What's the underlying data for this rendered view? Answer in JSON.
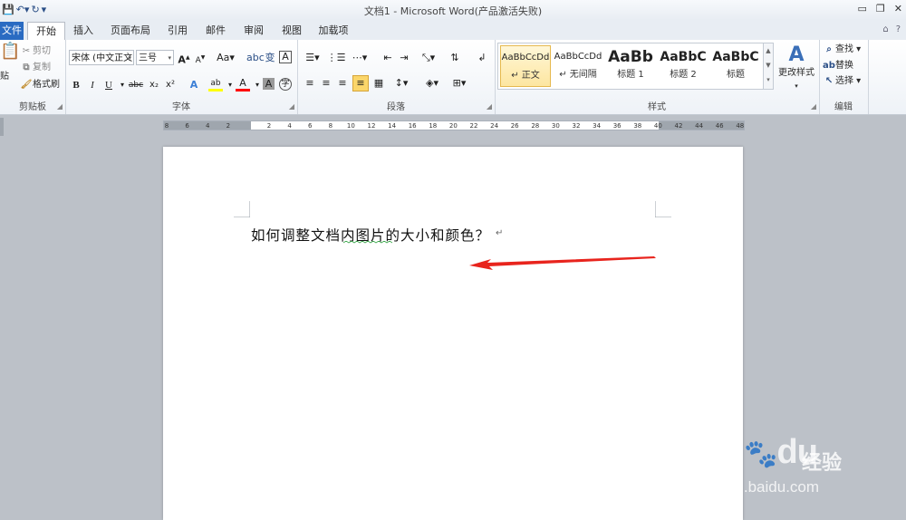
{
  "window": {
    "title": "文档1 - Microsoft Word(产品激活失败)",
    "qat": [
      "save-icon",
      "undo-icon",
      "redo-icon",
      "customize-icon"
    ]
  },
  "tabs": [
    "文件",
    "开始",
    "插入",
    "页面布局",
    "引用",
    "邮件",
    "审阅",
    "视图",
    "加载项"
  ],
  "active_tab": "开始",
  "clipboard": {
    "paste": "贴",
    "cut": "剪切",
    "copy": "复制",
    "format_painter": "格式刷",
    "label": "剪贴板"
  },
  "font": {
    "font_name": "宋体 (中文正文",
    "font_size": "三号",
    "grow": "A",
    "shrink": "A",
    "case": "Aa",
    "bold": "B",
    "italic": "I",
    "underline": "U",
    "strike": "abc",
    "subscript": "x₂",
    "superscript": "x²",
    "text_effect": "A",
    "highlight": "ab",
    "font_color": "A",
    "shade": "A",
    "label": "字体"
  },
  "paragraph": {
    "label": "段落"
  },
  "styles": {
    "items": [
      {
        "sample": "AaBbCcDd",
        "name": "正文",
        "prefix": "↵"
      },
      {
        "sample": "AaBbCcDd",
        "name": "无间隔",
        "prefix": "↵"
      },
      {
        "sample": "AaBb",
        "name": "标题 1"
      },
      {
        "sample": "AaBbC",
        "name": "标题 2"
      },
      {
        "sample": "AaBbC",
        "name": "标题"
      }
    ],
    "change_styles": "更改样式",
    "label": "样式"
  },
  "editing": {
    "find": "查找",
    "replace": "替换",
    "select": "选择",
    "label": "编辑"
  },
  "ruler_numbers": [
    "8",
    "6",
    "4",
    "2",
    "",
    "2",
    "4",
    "6",
    "8",
    "10",
    "12",
    "14",
    "16",
    "18",
    "20",
    "22",
    "24",
    "26",
    "28",
    "30",
    "32",
    "34",
    "36",
    "38",
    "40",
    "42",
    "44",
    "46",
    "48"
  ],
  "document": {
    "text": "如何调整文档内图片的大小和颜色？",
    "return_mark": "↵"
  },
  "watermark": {
    "brand": "Bai",
    "brand2": "du",
    "jingyan": "经验",
    "url": "jingyan.baidu.com"
  },
  "colors": {
    "file_tab": "#2a6bc2",
    "arrow": "#e8241d",
    "highlight": "#ffff00",
    "font_color": "#ff0000"
  }
}
